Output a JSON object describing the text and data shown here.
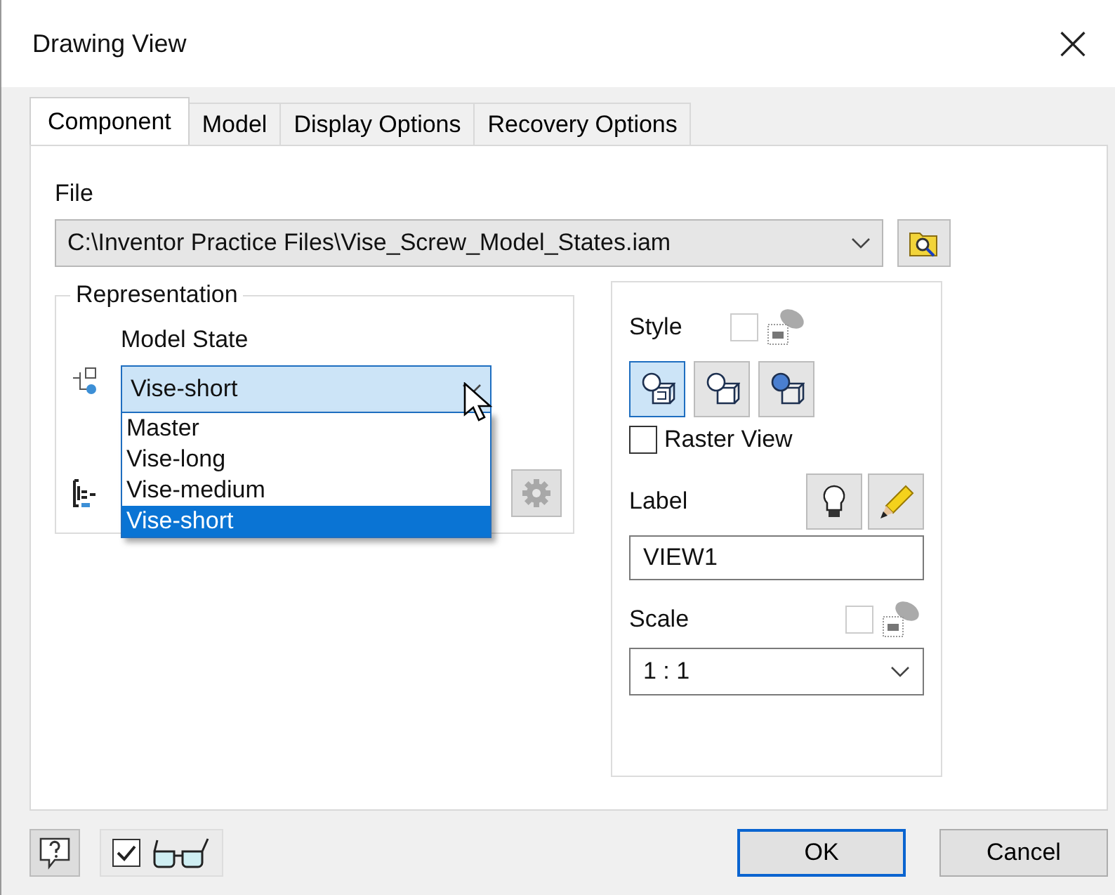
{
  "window": {
    "title": "Drawing View",
    "close": "×"
  },
  "tabs": [
    {
      "label": "Component",
      "selected": true
    },
    {
      "label": "Model",
      "selected": false
    },
    {
      "label": "Display Options",
      "selected": false
    },
    {
      "label": "Recovery Options",
      "selected": false
    }
  ],
  "file": {
    "label": "File",
    "value": "C:\\Inventor Practice Files\\Vise_Screw_Model_States.iam"
  },
  "representation": {
    "title": "Representation",
    "model_state_label": "Model State",
    "model_state_value": "Vise-short",
    "dropdown_open": true,
    "options": [
      {
        "label": "Master",
        "selected": false
      },
      {
        "label": "Vise-long",
        "selected": false
      },
      {
        "label": "Vise-medium",
        "selected": false
      },
      {
        "label": "Vise-short",
        "selected": true
      }
    ]
  },
  "style": {
    "label": "Style",
    "buttons": [
      {
        "kind": "hidden",
        "selected": true
      },
      {
        "kind": "removed",
        "selected": false
      },
      {
        "kind": "shaded",
        "selected": false
      }
    ],
    "checked": false
  },
  "raster_view": {
    "label": "Raster View",
    "checked": false
  },
  "label": {
    "label": "Label",
    "value": "VIEW1"
  },
  "scale": {
    "label": "Scale",
    "value": "1 : 1",
    "checked": false
  },
  "footer": {
    "preview_checked": true,
    "buttons": [
      {
        "label": "OK",
        "default": true
      },
      {
        "label": "Cancel",
        "default": false
      }
    ]
  }
}
